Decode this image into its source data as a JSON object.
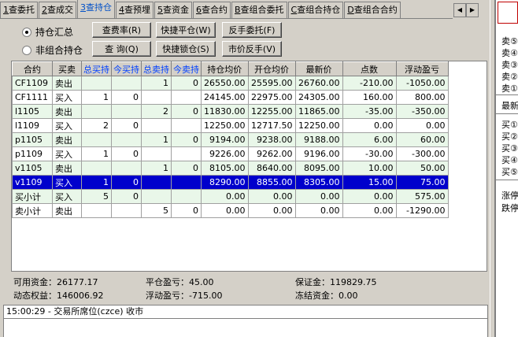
{
  "tabs": [
    {
      "key": "1",
      "label": "查委托"
    },
    {
      "key": "2",
      "label": "查成交"
    },
    {
      "key": "3",
      "label": "查持仓",
      "active": true
    },
    {
      "key": "4",
      "label": "查预埋"
    },
    {
      "key": "5",
      "label": "查资金"
    },
    {
      "key": "6",
      "label": "查合约"
    },
    {
      "key": "B",
      "label": "查组合委托"
    },
    {
      "key": "C",
      "label": "查组合持仓"
    },
    {
      "key": "D",
      "label": "查组合合约"
    }
  ],
  "radios": {
    "summary": "持仓汇总",
    "non_combo": "非组合持仓"
  },
  "buttons": {
    "fee_rate": "查费率(R)",
    "quick_close": "快捷平仓(W)",
    "reverse_order": "反手委托(F)",
    "query": "查 询(Q)",
    "quick_lock": "快捷锁仓(S)",
    "market_reverse": "市价反手(V)"
  },
  "table": {
    "headers": [
      "合约",
      "买卖",
      "总买持",
      "今买持",
      "总卖持",
      "今卖持",
      "持仓均价",
      "开仓均价",
      "最新价",
      "点数",
      "浮动盈亏"
    ],
    "rows": [
      [
        "CF1109",
        "卖出",
        "",
        "",
        "1",
        "0",
        "26550.00",
        "25595.00",
        "26760.00",
        "-210.00",
        "-1050.00"
      ],
      [
        "CF1111",
        "买入",
        "1",
        "0",
        "",
        "",
        "24145.00",
        "22975.00",
        "24305.00",
        "160.00",
        "800.00"
      ],
      [
        "l1105",
        "卖出",
        "",
        "",
        "2",
        "0",
        "11830.00",
        "12255.00",
        "11865.00",
        "-35.00",
        "-350.00"
      ],
      [
        "l1109",
        "买入",
        "2",
        "0",
        "",
        "",
        "12250.00",
        "12717.50",
        "12250.00",
        "0.00",
        "0.00"
      ],
      [
        "p1105",
        "卖出",
        "",
        "",
        "1",
        "0",
        "9194.00",
        "9238.00",
        "9188.00",
        "6.00",
        "60.00"
      ],
      [
        "p1109",
        "买入",
        "1",
        "0",
        "",
        "",
        "9226.00",
        "9262.00",
        "9196.00",
        "-30.00",
        "-300.00"
      ],
      [
        "v1105",
        "卖出",
        "",
        "",
        "1",
        "0",
        "8105.00",
        "8640.00",
        "8095.00",
        "10.00",
        "50.00"
      ],
      [
        "v1109",
        "买入",
        "1",
        "0",
        "",
        "",
        "8290.00",
        "8855.00",
        "8305.00",
        "15.00",
        "75.00"
      ],
      [
        "买小计",
        "买入",
        "5",
        "0",
        "",
        "",
        "0.00",
        "0.00",
        "0.00",
        "0.00",
        "575.00"
      ],
      [
        "卖小计",
        "卖出",
        "",
        "",
        "5",
        "0",
        "0.00",
        "0.00",
        "0.00",
        "0.00",
        "-1290.00"
      ]
    ],
    "selected_row": 7
  },
  "summary": {
    "available_label": "可用资金：",
    "available_value": "26177.17",
    "close_pl_label": "平仓盈亏：",
    "close_pl_value": "45.00",
    "margin_label": "保证金：",
    "margin_value": "119829.75",
    "equity_label": "动态权益：",
    "equity_value": "146006.92",
    "float_pl_label": "浮动盈亏：",
    "float_pl_value": "-715.00",
    "frozen_label": "冻结资金：",
    "frozen_value": "0.00"
  },
  "status_line": "15:00:29 - 交易所席位(czce) 收市",
  "right_panel": {
    "sell_labels": [
      "卖⑤",
      "卖④",
      "卖③",
      "卖②",
      "卖①"
    ],
    "latest": "最新",
    "buy_labels": [
      "买①",
      "买②",
      "买③",
      "买④",
      "买⑤"
    ],
    "limit_up": "涨停",
    "limit_down": "跌停"
  },
  "colors": {
    "stripe": "#e9f7e9",
    "selected": "#0000cc",
    "active_tab": "#0050c8"
  }
}
